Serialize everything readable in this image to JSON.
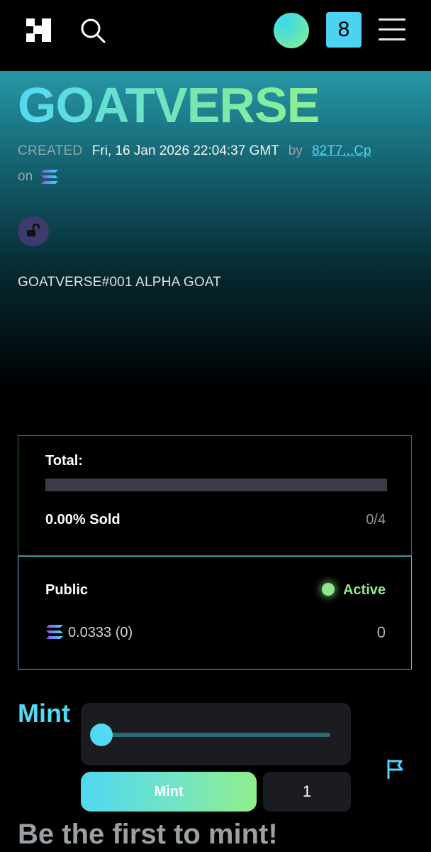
{
  "header": {
    "logo_icon": "brand-logo-icon",
    "search_icon": "search-icon",
    "avatar_colors": [
      "#52d9f4",
      "#8ff092"
    ],
    "cart_count": "8",
    "menu_icon": "hamburger-menu-icon"
  },
  "collection": {
    "title": "GOATVERSE",
    "created_label": "CREATED",
    "created_at": "Fri, 16 Jan 2026 22:04:37 GMT",
    "by_label": "by",
    "creator_address": "82T7...Cp",
    "on_label": "on",
    "chain_icon": "solana-icon",
    "lock_icon": "unlocked-padlock-icon",
    "description": "GOATVERSE#001 ALPHA GOAT"
  },
  "supply": {
    "total_label": "Total:",
    "sold_fraction": 0,
    "sold_label": "0.00% Sold",
    "sold_count": "0/4"
  },
  "phase": {
    "name": "Public",
    "status": "Active",
    "status_color": "#8fe88e",
    "price": "0.0333",
    "price_suffix": "(0)",
    "minted": "0"
  },
  "mint": {
    "heading": "Mint",
    "slider_value_fraction": 0,
    "button_label": "Mint",
    "quantity": "1",
    "report_icon": "flag-icon"
  },
  "cta": {
    "text": "Be the first to mint!"
  },
  "colors": {
    "accent": "#52d9f4",
    "accent_green": "#8ff092",
    "link": "#4ed6f5"
  }
}
